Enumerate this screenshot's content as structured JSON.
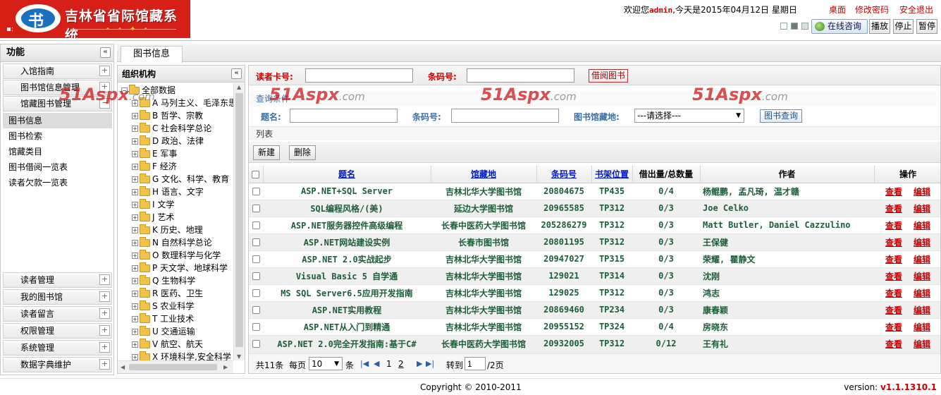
{
  "header": {
    "logo_text": "吉林省省际馆藏系统",
    "logo_mark": "书",
    "welcome_prefix": "欢迎您",
    "user": "admin",
    "welcome_suffix": ",今天是2015年04月12日 星期日",
    "links": [
      "桌面",
      "修改密码",
      "安全退出"
    ],
    "consult_label": "在线咨询",
    "media_buttons": [
      "播放",
      "停止",
      "暂停"
    ]
  },
  "func_panel": {
    "title": "功能",
    "collapse_glyph": "«",
    "sections_top": [
      "入馆指南",
      "图书馆信息管理",
      "馆藏图书管理"
    ],
    "items": [
      "图书信息",
      "图书检索",
      "馆藏类目",
      "图书借阅一览表",
      "读者欠款一览表"
    ],
    "sections_bottom": [
      "读者管理",
      "我的图书馆",
      "读者留言",
      "权限管理",
      "系统管理",
      "数据字典维护"
    ]
  },
  "tab": {
    "label": "图书信息"
  },
  "org_panel": {
    "title": "组织机构",
    "root": "全部数据",
    "nodes": [
      "A 马列主义、毛泽东思",
      "B 哲学、宗教",
      "C 社会科学总论",
      "D 政治、法律",
      "E 军事",
      "F 经济",
      "G 文化、科学、教育",
      "H 语言、文字",
      "I 文学",
      "J 艺术",
      "K 历史、地理",
      "N 自然科学总论",
      "O 数理科学与化学",
      "P 天文学、地球科学",
      "Q 生物科学",
      "R 医药、卫生",
      "S 农业科学",
      "T 工业技术",
      "U 交通运输",
      "V 航空、航天",
      "X 环境科学,安全科学"
    ]
  },
  "borrow": {
    "card_label": "读者卡号:",
    "barcode_label": "条码号:",
    "button": "借阅图书"
  },
  "query": {
    "head": "查询条件",
    "title_label": "题名:",
    "barcode_label": "条码号:",
    "library_label": "图书馆藏地:",
    "library_select": "---请选择---",
    "button": "图书查询"
  },
  "list": {
    "label": "列表",
    "new_button": "新建",
    "delete_button": "删除",
    "columns": [
      "题名",
      "馆藏地",
      "条码号",
      "书架位置",
      "借出量/总数量",
      "作者",
      "操作"
    ],
    "view_label": "查看",
    "edit_label": "编辑",
    "rows": [
      [
        "ASP.NET+SQL Server",
        "吉林北华大学图书馆",
        "20804675",
        "TP435",
        "0/4",
        "杨鲲鹏, 孟凡琦, 温才赣"
      ],
      [
        "SQL编程风格/(美)",
        "延边大学图书馆",
        "20965585",
        "TP312",
        "0/3",
        "Joe Celko"
      ],
      [
        "ASP.NET服务器控件高级编程",
        "长春中医药大学图书馆",
        "205286279",
        "TP312",
        "0/3",
        "Matt Butler, Daniel Cazzulino"
      ],
      [
        "ASP.NET网站建设实例",
        "长春市图书馆",
        "20801195",
        "TP312",
        "0/3",
        "王保健"
      ],
      [
        "ASP.NET 2.0实战起步",
        "吉林北华大学图书馆",
        "20947027",
        "TP315",
        "0/3",
        "荣耀, 瞿静文"
      ],
      [
        "Visual Basic 5 自学通",
        "吉林北华大学图书馆",
        "129021",
        "TP314",
        "0/3",
        "沈刚"
      ],
      [
        "MS SQL Server6.5应用开发指南",
        "吉林北华大学图书馆",
        "129025",
        "TP312",
        "0/3",
        "鸿志"
      ],
      [
        "ASP.NET实用教程",
        "吉林北华大学图书馆",
        "20869460",
        "TP234",
        "0/3",
        "康春颖"
      ],
      [
        "ASP.NET从入门到精通",
        "吉林北华大学图书馆",
        "20955152",
        "TP324",
        "0/4",
        "房晓东"
      ],
      [
        "ASP.NET 2.0完全开发指南:基于C#",
        "长春中医药大学图书馆",
        "20932005",
        "TP312",
        "0/12",
        "王有礼"
      ]
    ]
  },
  "pager": {
    "total": "共11条",
    "per_page_label": "每页",
    "per_page_value": "10",
    "unit": "条",
    "page1": "1",
    "page2": "2",
    "goto_label": "转到",
    "goto_value": "1",
    "total_pages": "/2页"
  },
  "watermark": {
    "text": "51Aspx",
    "suffix": ".com"
  },
  "footer": {
    "copyright": "Copyright © 2010-2011",
    "version_label": "version:",
    "version": "v1.1.1310.1"
  },
  "colors": {
    "accent_red": "#cc0000",
    "logo_red": "#d51f17",
    "link_blue": "#0018c8",
    "row_text_green": "#1c5e3a"
  }
}
